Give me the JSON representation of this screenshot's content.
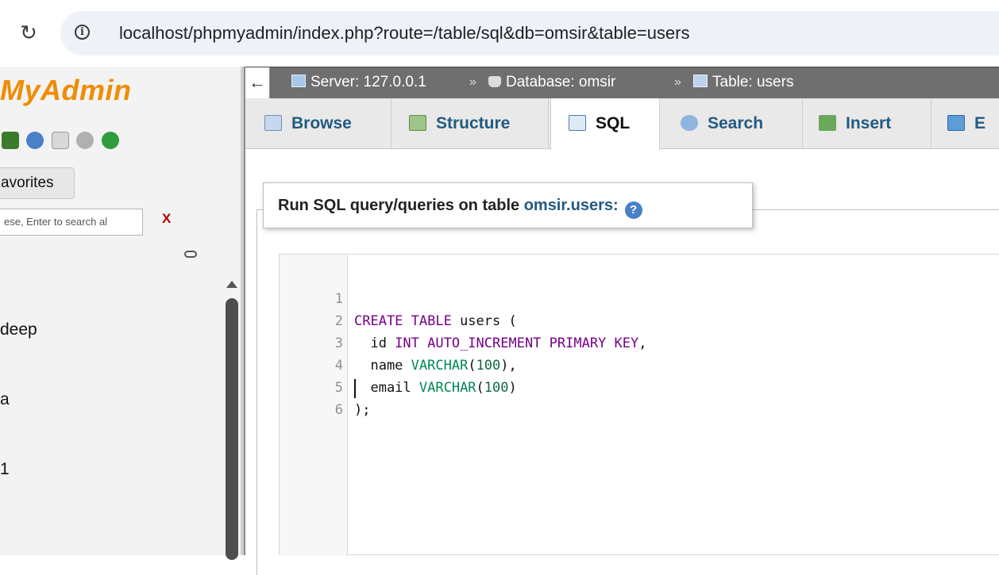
{
  "browser": {
    "url": "localhost/phpmyadmin/index.php?route=/table/sql&db=omsir&table=users",
    "icons": [
      "reload-icon",
      "site-info-icon"
    ]
  },
  "nav": {
    "logo_text": "MyAdmin",
    "favorites_label": "avorites",
    "filter_placeholder": "ese, Enter to search al",
    "clear_label": "X",
    "databases": [
      "deep",
      "a",
      "1"
    ],
    "icons": [
      "home-icon",
      "help-icon",
      "docs-icon",
      "settings-icon",
      "reload-icon",
      "link-icon"
    ]
  },
  "breadcrumb": {
    "server": "Server: 127.0.0.1",
    "database": "Database: omsir",
    "table": "Table: users",
    "separator": "»"
  },
  "tabs": [
    {
      "label": "Browse",
      "icon": "browse-icon"
    },
    {
      "label": "Structure",
      "icon": "structure-icon"
    },
    {
      "label": "SQL",
      "icon": "sql-icon",
      "active": true
    },
    {
      "label": "Search",
      "icon": "search-icon"
    },
    {
      "label": "Insert",
      "icon": "insert-icon"
    },
    {
      "label": "E",
      "icon": "export-icon"
    }
  ],
  "query_panel": {
    "legend_prefix": "Run SQL query/queries on table ",
    "legend_table": "omsir.users:"
  },
  "editor": {
    "line_numbers": [
      "1",
      "2",
      "3",
      "4",
      "5",
      "6"
    ],
    "tokens": {
      "l1_kw": "CREATE TABLE",
      "l1_rest": " users (",
      "l2_name": "  id ",
      "l2_kw": "INT AUTO_INCREMENT PRIMARY KEY",
      "l2_end": ",",
      "l3_name": "  name ",
      "l3_type": "VARCHAR",
      "l3_open": "(",
      "l3_num": "100",
      "l3_close": "),",
      "l4_name": "  email ",
      "l4_type": "VARCHAR",
      "l4_open": "(",
      "l4_num": "100",
      "l4_close": ")",
      "l5": ");"
    }
  },
  "colors": {
    "logo": "#f08c00",
    "link": "#235a81",
    "keyword": "#770088",
    "type": "#008855",
    "breadcrumb_bg": "#6f6f6f"
  }
}
